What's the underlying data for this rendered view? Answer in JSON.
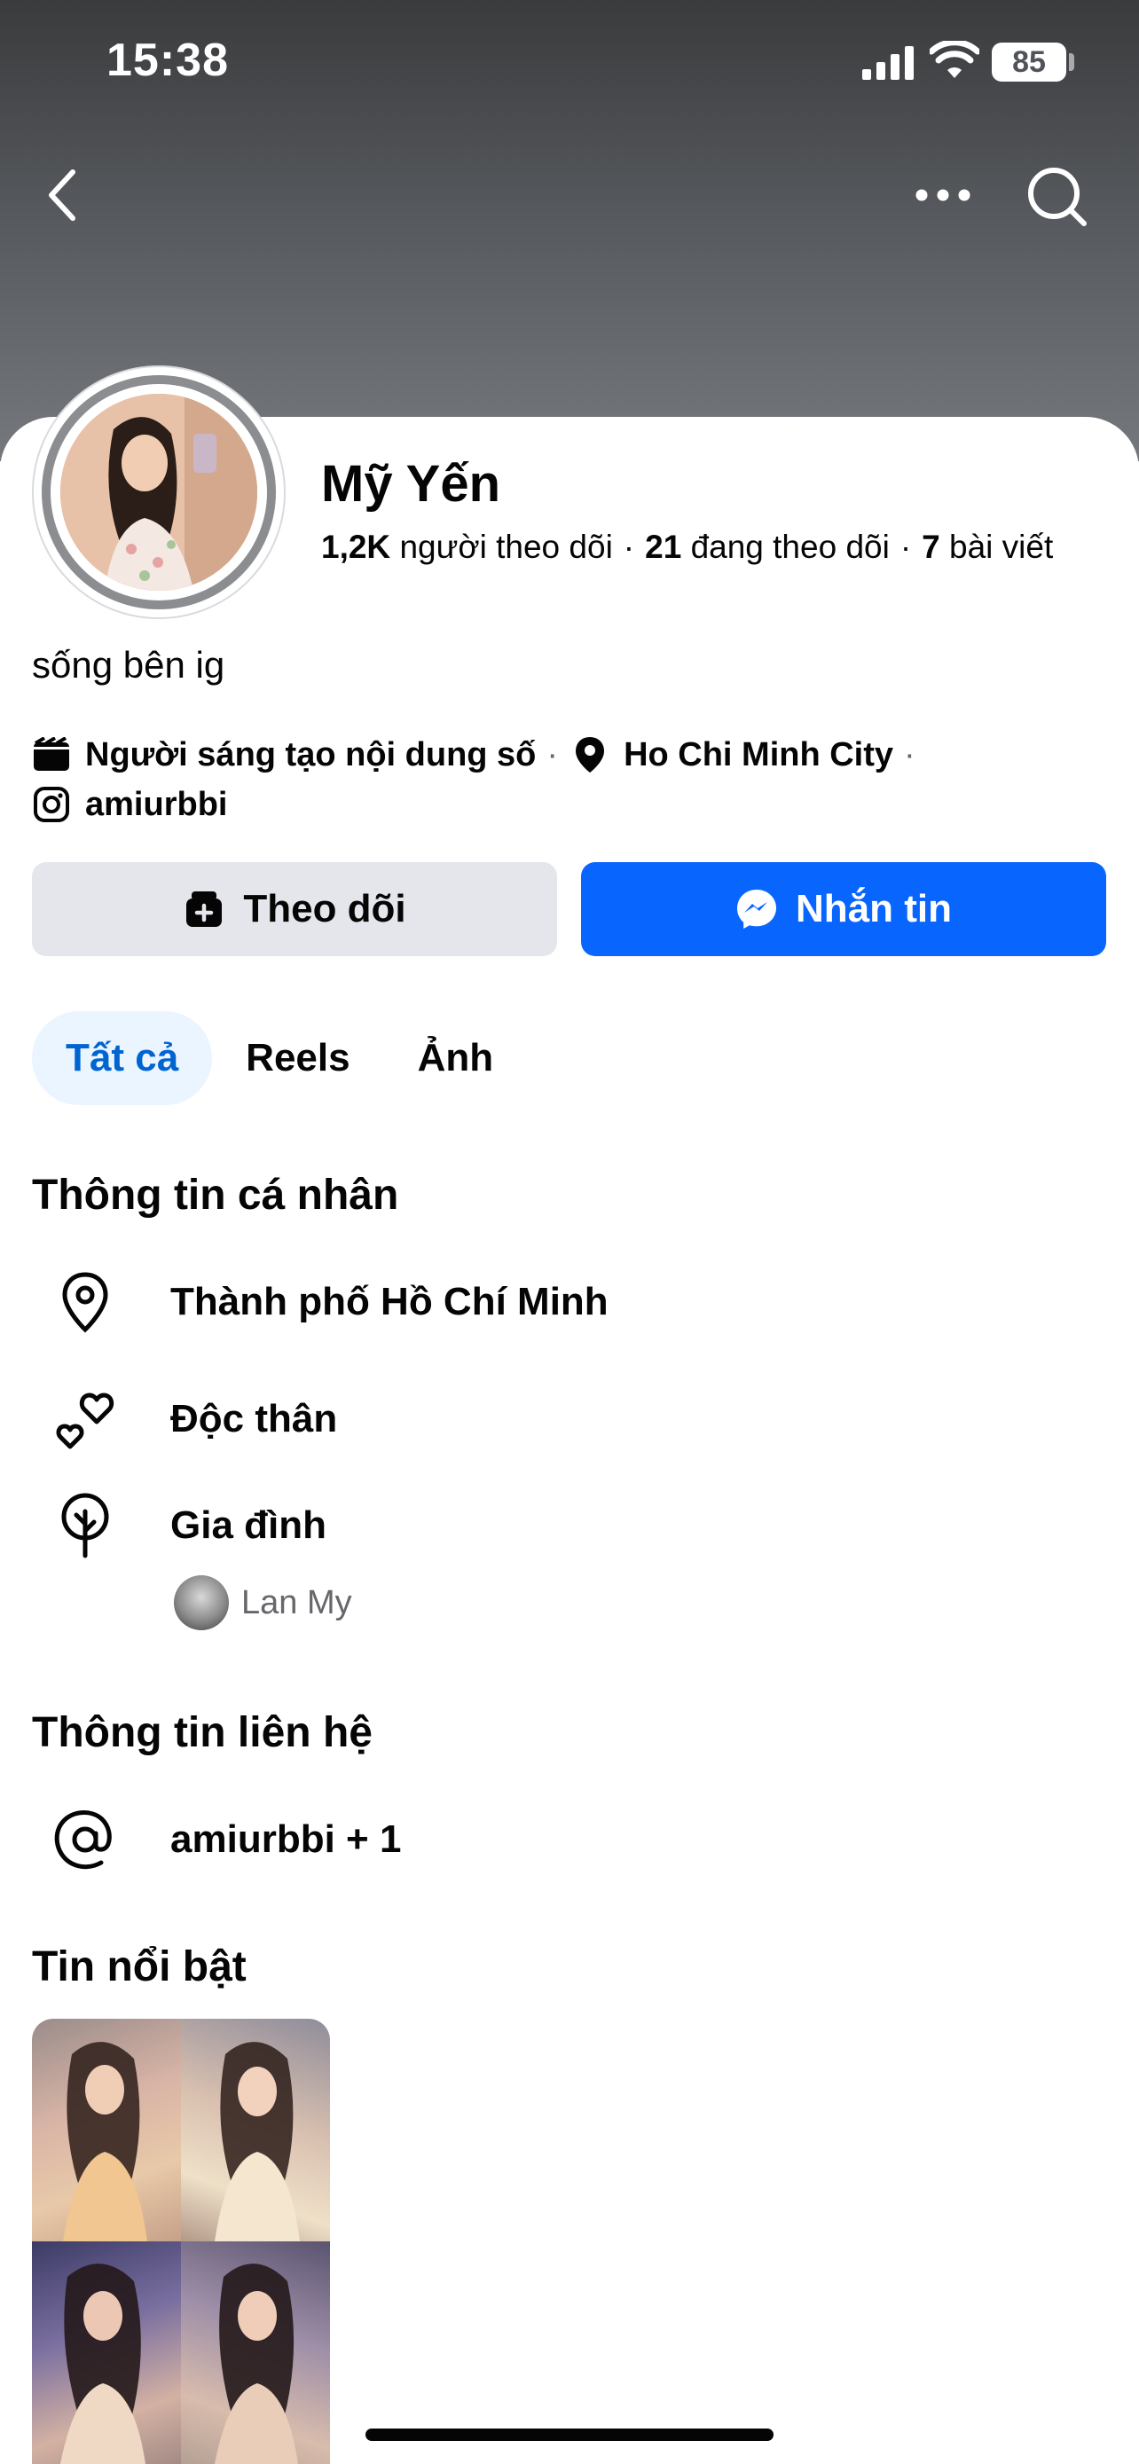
{
  "status_bar": {
    "time": "15:38",
    "battery": "85"
  },
  "profile": {
    "name": "Mỹ Yến",
    "followers_count": "1,2K",
    "followers_label": "người theo dõi",
    "following_count": "21",
    "following_label": "đang theo dõi",
    "posts_count": "7",
    "posts_label": "bài viết",
    "bio": "sống bên ig",
    "category": "Người sáng tạo nội dung số",
    "location": "Ho Chi Minh City",
    "instagram": "amiurbbi"
  },
  "actions": {
    "follow_label": "Theo dõi",
    "message_label": "Nhắn tin"
  },
  "tabs": [
    {
      "label": "Tất cả",
      "active": true
    },
    {
      "label": "Reels",
      "active": false
    },
    {
      "label": "Ảnh",
      "active": false
    }
  ],
  "personal_info": {
    "title": "Thông tin cá nhân",
    "city": "Thành phố Hồ Chí Minh",
    "relationship": "Độc thân",
    "family_label": "Gia đình",
    "family_member": "Lan My"
  },
  "contact_info": {
    "title": "Thông tin liên hệ",
    "handle": "amiurbbi + 1"
  },
  "highlights": {
    "title": "Tin nổi bật"
  },
  "colors": {
    "accent": "#0866ff",
    "tab_active_bg": "#ebf5ff",
    "tab_active_text": "#0064d1",
    "secondary_button": "#e4e6eb"
  }
}
